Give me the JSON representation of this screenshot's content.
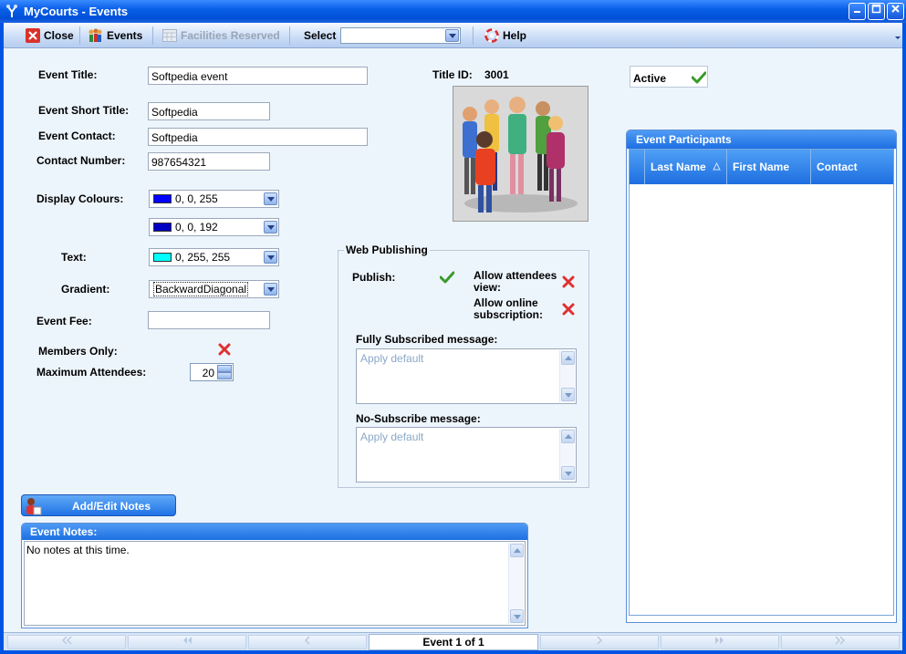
{
  "window": {
    "title": "MyCourts - Events"
  },
  "toolbar": {
    "close_label": "Close",
    "events_label": "Events",
    "facilities_label": "Facilities Reserved",
    "select_label": "Select",
    "select_value": "",
    "help_label": "Help"
  },
  "form": {
    "event_title_label": "Event Title:",
    "event_title_value": "Softpedia event",
    "event_short_title_label": "Event Short Title:",
    "event_short_title_value": "Softpedia",
    "event_contact_label": "Event Contact:",
    "event_contact_value": "Softpedia",
    "contact_number_label": "Contact Number:",
    "contact_number_value": "987654321",
    "display_colours_label": "Display Colours:",
    "colour1": {
      "value": "0, 0, 255",
      "swatch": "#0000ff"
    },
    "colour2": {
      "value": "0, 0, 192",
      "swatch": "#0000c0"
    },
    "text_label": "Text:",
    "text_colour": {
      "value": "0, 255, 255",
      "swatch": "#00ffff"
    },
    "gradient_label": "Gradient:",
    "gradient_value": "BackwardDiagonal",
    "event_fee_label": "Event Fee:",
    "event_fee_value": "",
    "members_only_label": "Members Only:",
    "max_attendees_label": "Maximum Attendees:",
    "max_attendees_value": "20"
  },
  "title_id": {
    "label": "Title ID:",
    "value": "3001"
  },
  "active": {
    "label": "Active"
  },
  "web_publishing": {
    "title": "Web Publishing",
    "publish_label": "Publish:",
    "allow_attendees_label": "Allow attendees view:",
    "allow_online_label": "Allow online subscription:",
    "fully_subscribed_label": "Fully Subscribed message:",
    "fully_subscribed_placeholder": "Apply default",
    "no_subscribe_label": "No-Subscribe message:",
    "no_subscribe_placeholder": "Apply default"
  },
  "participants": {
    "title": "Event Participants",
    "columns": [
      "Last Name",
      "First Name",
      "Contact"
    ]
  },
  "notes": {
    "button_label": "Add/Edit Notes",
    "title": "Event Notes:",
    "text": "No notes at this time."
  },
  "navigator": {
    "status": "Event 1 of 1"
  },
  "colors": {
    "accent": "#1d6fe3",
    "background": "#edf5fc",
    "cross": "#e03030",
    "check": "#3a9a2a"
  }
}
